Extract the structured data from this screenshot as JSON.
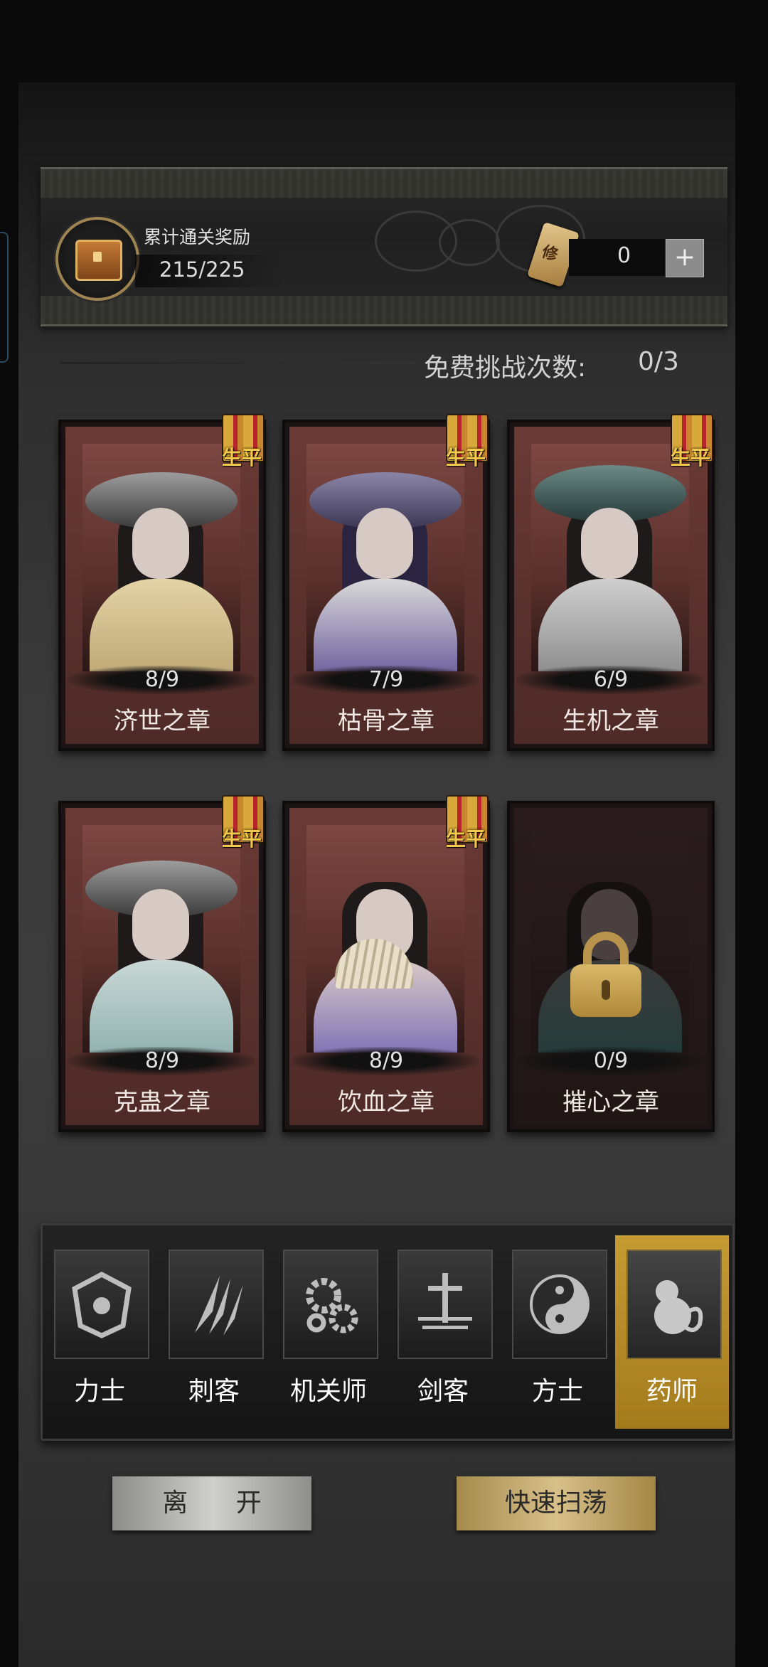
{
  "header": {
    "reward_title": "累计通关奖励",
    "reward_progress": "215/225",
    "ticket_icon_text": "修",
    "ticket_count": "0",
    "plus_label": "+"
  },
  "free_challenges": {
    "label": "免费挑战次数:",
    "count": "0/3"
  },
  "chapters": [
    {
      "name": "济世之章",
      "progress": "8/9",
      "badge": "生平",
      "locked": false
    },
    {
      "name": "枯骨之章",
      "progress": "7/9",
      "badge": "生平",
      "locked": false
    },
    {
      "name": "生机之章",
      "progress": "6/9",
      "badge": "生平",
      "locked": false
    },
    {
      "name": "克蛊之章",
      "progress": "8/9",
      "badge": "生平",
      "locked": false
    },
    {
      "name": "饮血之章",
      "progress": "8/9",
      "badge": "生平",
      "locked": false
    },
    {
      "name": "摧心之章",
      "progress": "0/9",
      "badge": "",
      "locked": true
    }
  ],
  "classes": [
    {
      "label": "力士",
      "icon": "shield-icon",
      "active": false
    },
    {
      "label": "刺客",
      "icon": "claw-blade-icon",
      "active": false
    },
    {
      "label": "机关师",
      "icon": "gears-icon",
      "active": false
    },
    {
      "label": "剑客",
      "icon": "sword-icon",
      "active": false
    },
    {
      "label": "方士",
      "icon": "yin-yang-icon",
      "active": false
    },
    {
      "label": "药师",
      "icon": "gourd-icon",
      "active": true
    }
  ],
  "buttons": {
    "leave": "离 开",
    "sweep": "快速扫荡"
  },
  "colors": {
    "accent_gold": "#c59b33",
    "card_red": "#6a3a36",
    "lock_gold": "#b8934b"
  }
}
